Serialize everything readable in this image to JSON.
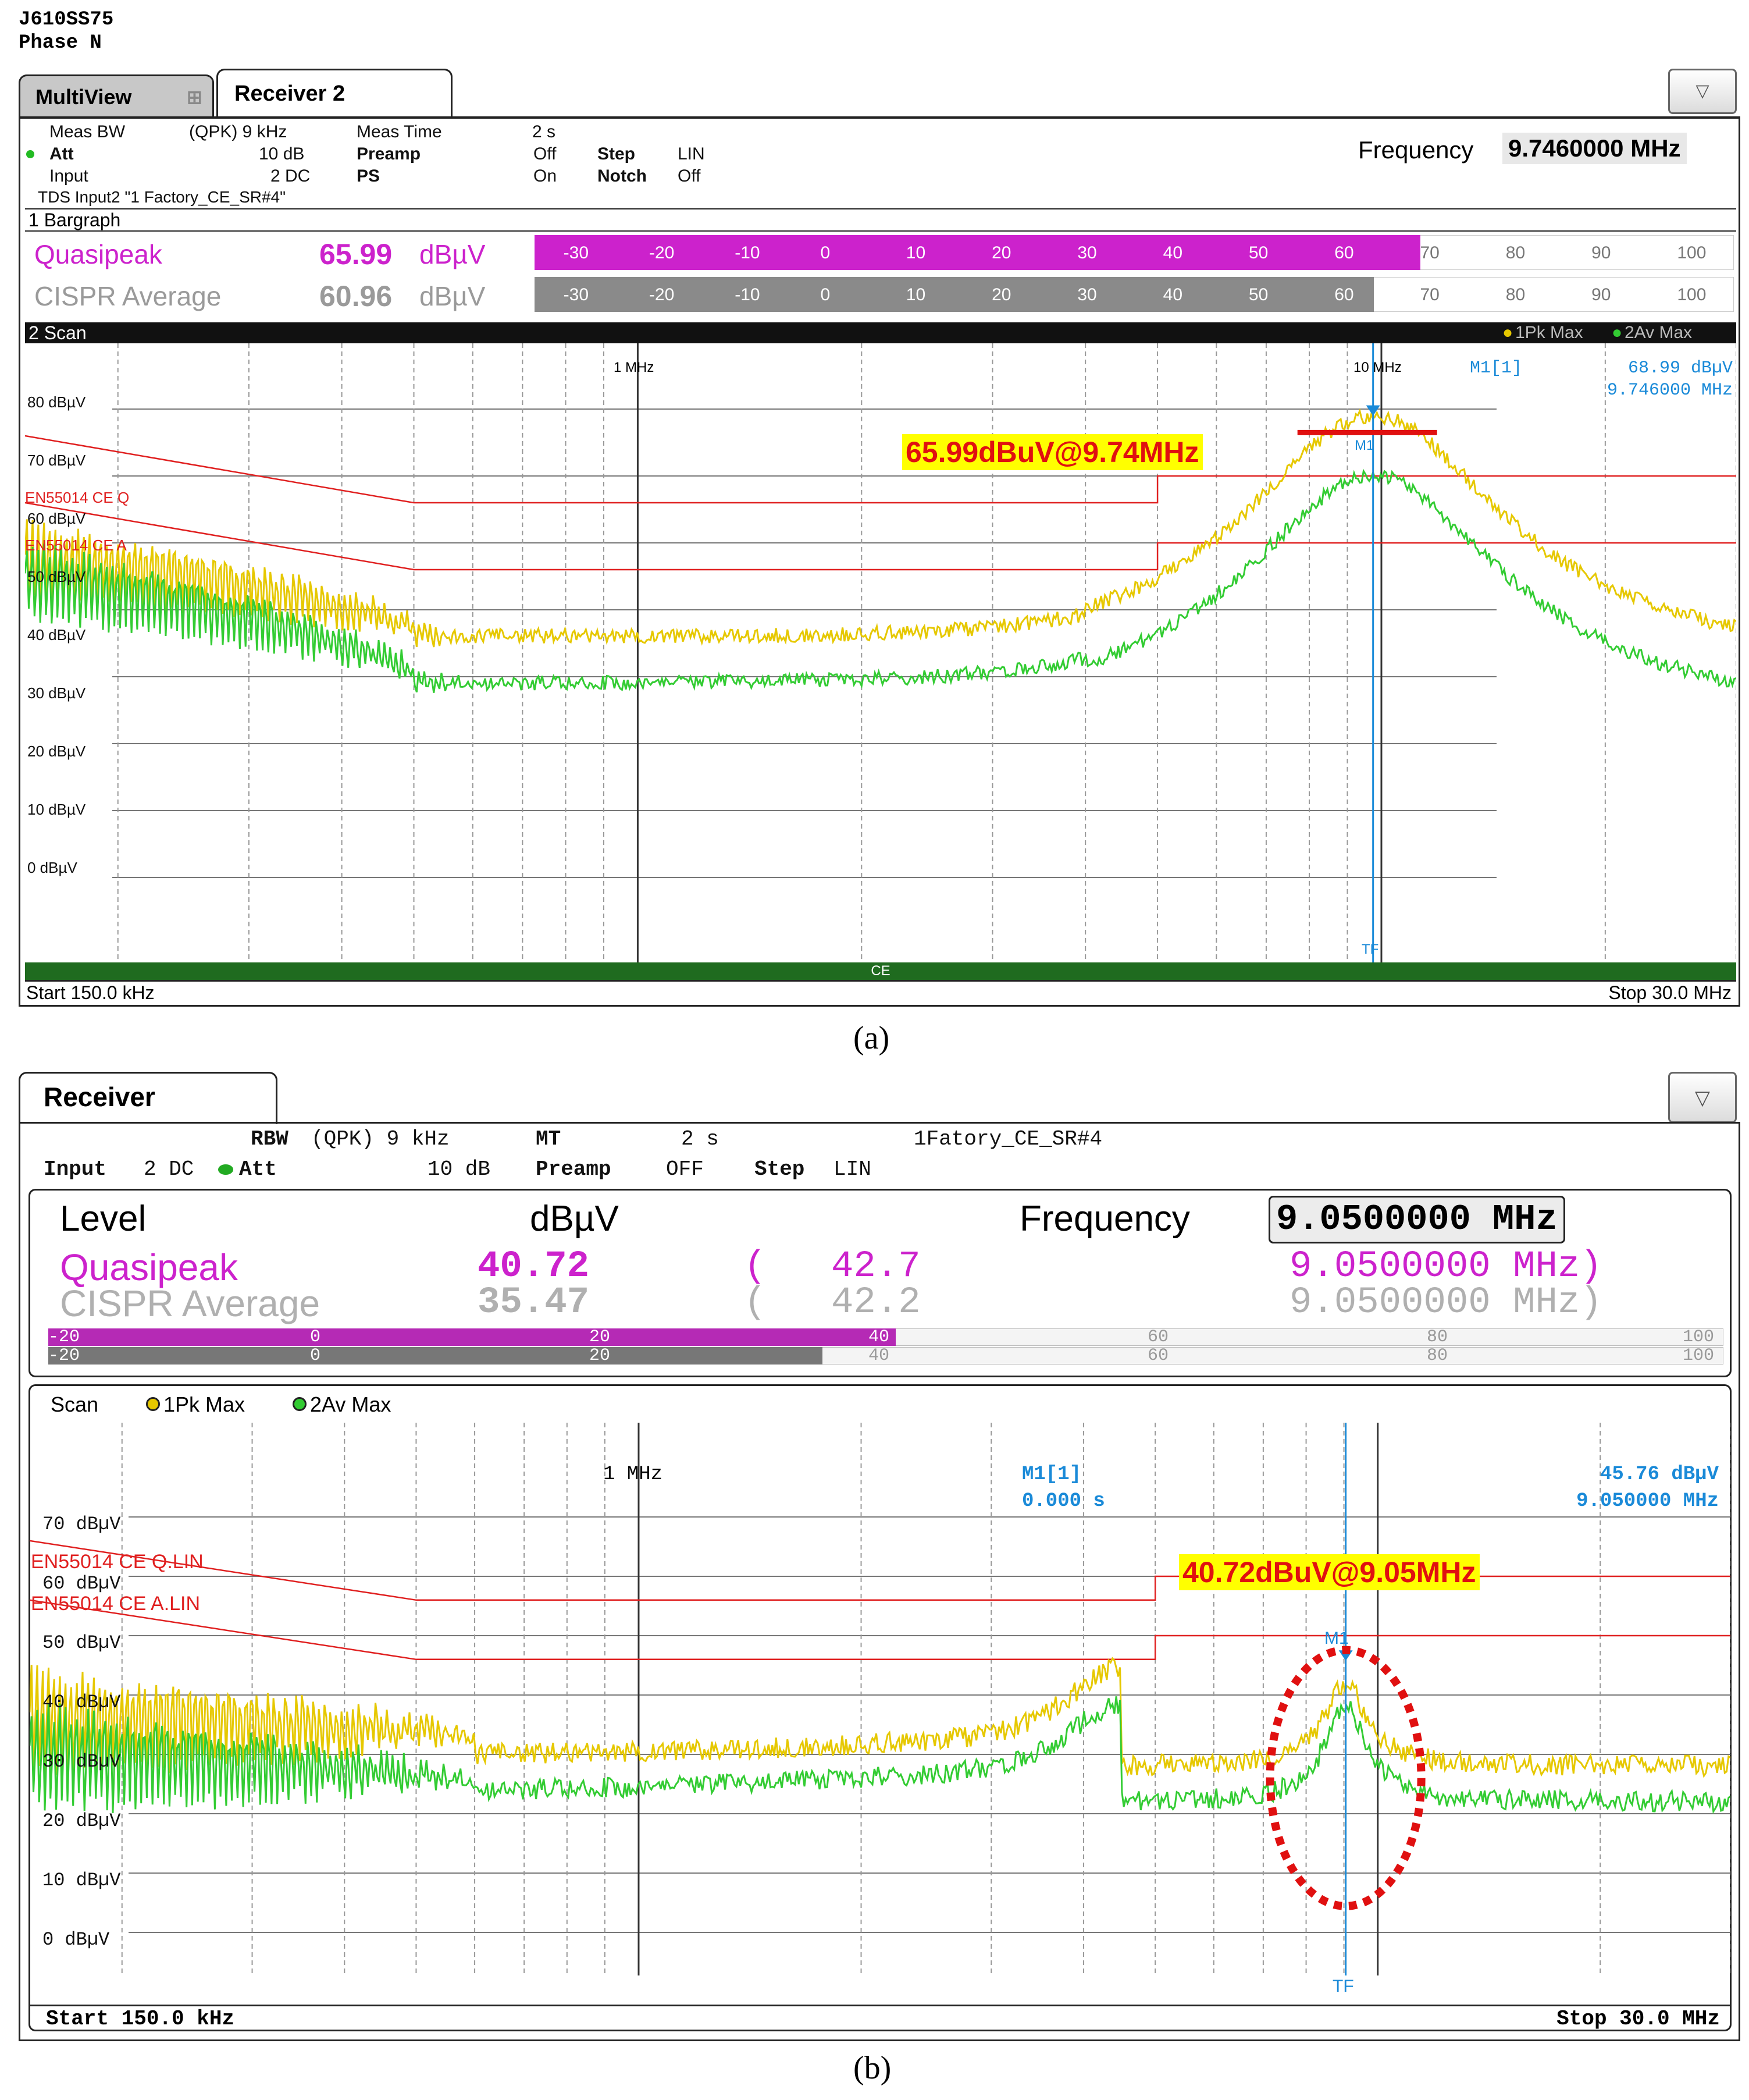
{
  "panel_a": {
    "device": "J610SS75",
    "phase": "Phase N",
    "tabs": {
      "multiview": "MultiView",
      "receiver": "Receiver 2"
    },
    "settings": {
      "meas_bw_label": "Meas BW",
      "meas_bw_value": "(QPK) 9 kHz",
      "meas_time_label": "Meas Time",
      "meas_time_value": "2 s",
      "att_label": "Att",
      "att_value": "10 dB",
      "preamp_label": "Preamp",
      "preamp_value": "Off",
      "step_label": "Step",
      "step_value": "LIN",
      "input_label": "Input",
      "input_value": "2 DC",
      "ps_label": "PS",
      "ps_value": "On",
      "notch_label": "Notch",
      "notch_value": "Off",
      "tds": "TDS Input2 \"1 Factory_CE_SR#4\""
    },
    "frequency_label": "Frequency",
    "frequency_value": "9.7460000 MHz",
    "bargraph_title": "1 Bargraph",
    "bargraph_ticks": [
      "-30",
      "-20",
      "-10",
      "0",
      "10",
      "20",
      "30",
      "40",
      "50",
      "60",
      "70",
      "80",
      "90",
      "100"
    ],
    "quasipeak": {
      "label": "Quasipeak",
      "value": "65.99",
      "unit": "dBµV",
      "level": 65.99
    },
    "average": {
      "label": "CISPR Average",
      "value": "60.96",
      "unit": "dBµV",
      "level": 60.96
    },
    "scan_title": "2 Scan",
    "legend": [
      "1Pk Max",
      "2Av Max"
    ],
    "marker": {
      "name": "M1[1]",
      "level": "68.99 dBµV",
      "freq": "9.746000 MHz",
      "tag": "M1",
      "tf": "TF"
    },
    "freq_labels": [
      "1 MHz",
      "10 MHz"
    ],
    "y_labels": [
      "80 dBµV",
      "70 dBµV",
      "60 dBµV",
      "50 dBµV",
      "40 dBµV",
      "30 dBµV",
      "20 dBµV",
      "10 dBµV",
      "0 dBµV"
    ],
    "limit_labels": [
      "EN55014 CE Q",
      "EN55014 CE A"
    ],
    "annotation": "65.99dBuV@9.74MHz",
    "ce_label": "CE",
    "start": "Start 150.0 kHz",
    "stop": "Stop 30.0 MHz"
  },
  "caption_a": "(a)",
  "panel_b": {
    "tab": "Receiver",
    "settings": {
      "rbw_label": "RBW",
      "rbw_value": "(QPK) 9 kHz",
      "mt_label": "MT",
      "mt_value": "2 s",
      "name": "1Fatory_CE_SR#4",
      "input_label": "Input",
      "input_value": "2 DC",
      "att_label": "Att",
      "att_value": "10 dB",
      "preamp_label": "Preamp",
      "preamp_value": "OFF",
      "step_label": "Step",
      "step_value": "LIN"
    },
    "level_label": "Level",
    "unit_label": "dBµV",
    "frequency_label": "Frequency",
    "frequency_value": "9.0500000 MHz",
    "quasipeak": {
      "label": "Quasipeak",
      "value": "40.72",
      "max_open": "(",
      "max": "42.7",
      "freq": "9.0500000 MHz)",
      "level": 40.72
    },
    "average": {
      "label": "CISPR Average",
      "value": "35.47",
      "max_open": "(",
      "max": "42.2",
      "freq": "9.0500000 MHz)",
      "level": 35.47
    },
    "bar_ticks": [
      "-20",
      "0",
      "20",
      "40",
      "60",
      "80",
      "100"
    ],
    "scan_title": "Scan",
    "legend": [
      "1Pk Max",
      "2Av Max"
    ],
    "marker": {
      "name": "M1[1]",
      "time": "0.000 s",
      "level": "45.76 dBµV",
      "freq": "9.050000 MHz",
      "tag": "M1",
      "tf": "TF"
    },
    "freq_label": "1 MHz",
    "y_labels": [
      "70 dBµV",
      "60 dBµV",
      "50 dBµV",
      "40 dBµV",
      "30 dBµV",
      "20 dBµV",
      "10 dBµV",
      "0 dBµV"
    ],
    "limit_labels": [
      "EN55014 CE Q.LIN",
      "EN55014 CE A.LIN"
    ],
    "annotation": "40.72dBuV@9.05MHz",
    "start": "Start 150.0 kHz",
    "stop": "Stop 30.0 MHz"
  },
  "caption_b": "(b)",
  "colors": {
    "magenta": "#cc22cc",
    "yellow": "#e6c800",
    "green": "#33cc33",
    "red": "#e02020",
    "blue": "#1a8ad8"
  }
}
